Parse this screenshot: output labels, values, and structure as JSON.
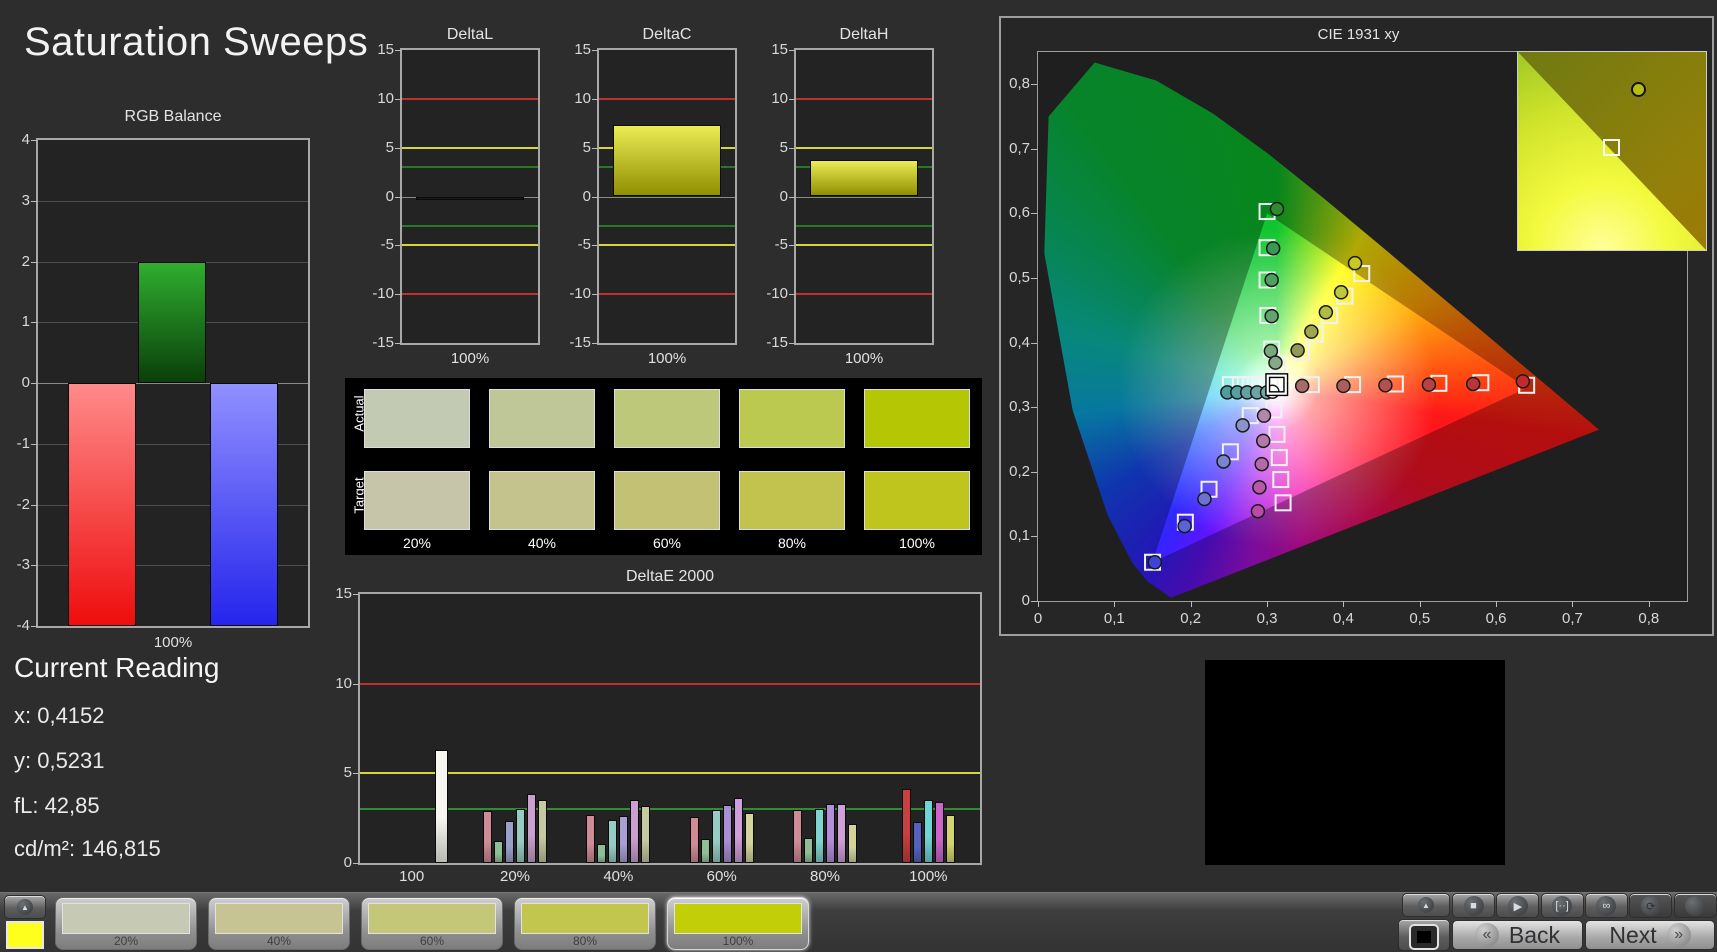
{
  "page": {
    "title": "Saturation Sweeps"
  },
  "current_reading": {
    "heading": "Current Reading",
    "lines": [
      "x: 0,4152",
      "y: 0,5231",
      "fL: 42,85",
      "cd/m²: 146,815"
    ]
  },
  "swatch_panel": {
    "row_labels": [
      "Actual",
      "Target"
    ],
    "column_labels": [
      "20%",
      "40%",
      "60%",
      "80%",
      "100%"
    ],
    "actual_colors": [
      "#c3cab3",
      "#bfc697",
      "#bdc87b",
      "#bcc950",
      "#b5c704"
    ],
    "target_colors": [
      "#c6c5a9",
      "#c4c28d",
      "#c3c274",
      "#c2c24e",
      "#bfc51d"
    ]
  },
  "bottom_bar": {
    "sample_color": "#ffff1e",
    "arrow_glyph": "▲",
    "patches": [
      {
        "label": "20%",
        "color": "#c6c9b3",
        "selected": false
      },
      {
        "label": "40%",
        "color": "#c5c492",
        "selected": false
      },
      {
        "label": "60%",
        "color": "#c4c778",
        "selected": false
      },
      {
        "label": "80%",
        "color": "#c2c64f",
        "selected": false
      },
      {
        "label": "100%",
        "color": "#c2cf08",
        "selected": true
      }
    ],
    "icons": [
      {
        "name": "stop",
        "glyph": "■",
        "disabled": false
      },
      {
        "name": "play",
        "glyph": "▶",
        "disabled": false
      },
      {
        "name": "bracket-dots",
        "glyph": "[··]",
        "disabled": false
      },
      {
        "name": "infinity",
        "glyph": "∞",
        "disabled": false
      },
      {
        "name": "refresh",
        "glyph": "⟳",
        "disabled": true
      },
      {
        "name": "blank",
        "glyph": "",
        "disabled": true
      }
    ],
    "nav": {
      "back_glyph": "«",
      "back_label": "Back",
      "next_label": "Next",
      "next_glyph": "»"
    }
  },
  "chart_data": [
    {
      "id": "rgb_balance",
      "type": "bar",
      "title": "RGB Balance",
      "xlabel": "100%",
      "ylim": [
        -4,
        4
      ],
      "yticks": [
        4,
        3,
        2,
        1,
        0,
        -1,
        -2,
        -3,
        -4
      ],
      "categories": [
        "Red",
        "Green",
        "Blue"
      ],
      "values": [
        -4,
        2,
        -4
      ],
      "bar_colors": [
        [
          "#ff8a8a",
          "#ee0d0d"
        ],
        [
          "#2fae2f",
          "#0a3f0a"
        ],
        [
          "#9090ff",
          "#2525ec"
        ]
      ]
    },
    {
      "id": "delta_l",
      "type": "delta_bar",
      "title": "DeltaL",
      "xlabel": "100%",
      "ylim": [
        -15,
        15
      ],
      "yticks": [
        15,
        10,
        5,
        0,
        -5,
        -10,
        -15
      ],
      "ref_lines": [
        {
          "value": 10,
          "color": "#c03030"
        },
        {
          "value": -10,
          "color": "#c03030"
        },
        {
          "value": 5,
          "color": "#d6d63a"
        },
        {
          "value": -5,
          "color": "#d6d63a"
        },
        {
          "value": 3,
          "color": "#267a26"
        },
        {
          "value": -3,
          "color": "#267a26"
        }
      ],
      "value": -0.35,
      "bar_color": [
        "#242424",
        "#101010"
      ]
    },
    {
      "id": "delta_c",
      "type": "delta_bar",
      "title": "DeltaC",
      "xlabel": "100%",
      "ylim": [
        -15,
        15
      ],
      "yticks": [
        15,
        10,
        5,
        0,
        -5,
        -10,
        -15
      ],
      "ref_lines": [
        {
          "value": 10,
          "color": "#c03030"
        },
        {
          "value": -10,
          "color": "#c03030"
        },
        {
          "value": 5,
          "color": "#d6d63a"
        },
        {
          "value": -5,
          "color": "#d6d63a"
        },
        {
          "value": 3,
          "color": "#267a26"
        },
        {
          "value": -3,
          "color": "#267a26"
        }
      ],
      "value": 7.3,
      "bar_color": [
        "#ecec55",
        "#8f8f02"
      ]
    },
    {
      "id": "delta_h",
      "type": "delta_bar",
      "title": "DeltaH",
      "xlabel": "100%",
      "ylim": [
        -15,
        15
      ],
      "yticks": [
        15,
        10,
        5,
        0,
        -5,
        -10,
        -15
      ],
      "ref_lines": [
        {
          "value": 10,
          "color": "#c03030"
        },
        {
          "value": -10,
          "color": "#c03030"
        },
        {
          "value": 5,
          "color": "#d6d63a"
        },
        {
          "value": -5,
          "color": "#d6d63a"
        },
        {
          "value": 3,
          "color": "#267a26"
        },
        {
          "value": -3,
          "color": "#267a26"
        }
      ],
      "value": 3.7,
      "bar_color": [
        "#ecec55",
        "#8f8f02"
      ]
    },
    {
      "id": "delta_e",
      "type": "grouped_bar",
      "title": "DeltaE 2000",
      "ylim": [
        0,
        15
      ],
      "yticks": [
        15,
        10,
        5,
        0
      ],
      "ref_lines": [
        {
          "value": 10,
          "color": "#c03030"
        },
        {
          "value": 5,
          "color": "#d6d63a"
        },
        {
          "value": 3,
          "color": "#2d8f2d"
        }
      ],
      "groups": [
        {
          "label": "100",
          "offset": 30,
          "bars": [
            {
              "color": "#f7f7f0",
              "value": 6.3,
              "width": 13
            }
          ]
        },
        {
          "label": "20%",
          "offset": 0,
          "bars": [
            {
              "color": "#cf8c94",
              "value": 2.9
            },
            {
              "color": "#8fbf96",
              "value": 1.25
            },
            {
              "color": "#9aa0cc",
              "value": 2.35
            },
            {
              "color": "#96ccc4",
              "value": 3.0
            },
            {
              "color": "#c9a0cf",
              "value": 3.85
            },
            {
              "color": "#c6c8a0",
              "value": 3.5
            }
          ]
        },
        {
          "label": "40%",
          "offset": 0,
          "bars": [
            {
              "color": "#cf8c94",
              "value": 2.7
            },
            {
              "color": "#8fbf96",
              "value": 1.05
            },
            {
              "color": "#96ccc4",
              "value": 2.4
            },
            {
              "color": "#a99fd4",
              "value": 2.6
            },
            {
              "color": "#cba0d0",
              "value": 3.5
            },
            {
              "color": "#c6c8a0",
              "value": 3.2
            }
          ]
        },
        {
          "label": "60%",
          "offset": 0,
          "bars": [
            {
              "color": "#cf8c94",
              "value": 2.55
            },
            {
              "color": "#8fbf96",
              "value": 1.35
            },
            {
              "color": "#96ccc4",
              "value": 2.95
            },
            {
              "color": "#a98fd4",
              "value": 3.25
            },
            {
              "color": "#cf9fd9",
              "value": 3.6
            },
            {
              "color": "#d4d4a0",
              "value": 2.8
            }
          ]
        },
        {
          "label": "80%",
          "offset": 0,
          "bars": [
            {
              "color": "#cf8c94",
              "value": 2.95
            },
            {
              "color": "#8fbf96",
              "value": 1.4
            },
            {
              "color": "#7fd4cf",
              "value": 3.0
            },
            {
              "color": "#b48fd9",
              "value": 3.3
            },
            {
              "color": "#d0a0d9",
              "value": 3.3
            },
            {
              "color": "#d4d49a",
              "value": 2.2
            }
          ]
        },
        {
          "label": "100%",
          "offset": 0,
          "bars": [
            {
              "color": "#c94040",
              "value": 4.1
            },
            {
              "color": "#5560c0",
              "value": 2.3
            },
            {
              "color": "#6fd4d4",
              "value": 3.5
            },
            {
              "color": "#cc66cc",
              "value": 3.4
            },
            {
              "color": "#d4d470",
              "value": 2.7
            }
          ]
        }
      ]
    },
    {
      "id": "cie",
      "type": "cie",
      "title": "CIE 1931 xy",
      "axis_max": 0.85,
      "x_tick_labels": [
        "0",
        "0,1",
        "0,2",
        "0,3",
        "0,4",
        "0,5",
        "0,6",
        "0,7",
        "0,8"
      ],
      "y_tick_labels": [
        "0,8",
        "0,7",
        "0,6",
        "0,5",
        "0,4",
        "0,3",
        "0,2",
        "0,1",
        "0"
      ],
      "gamut_triangle": [
        [
          0.64,
          0.33
        ],
        [
          0.3,
          0.6
        ],
        [
          0.15,
          0.06
        ]
      ],
      "white_target": [
        0.3127,
        0.335
      ],
      "white_measurement": [
        0.307,
        0.324
      ],
      "targets": [
        [
          0.3,
          0.603
        ],
        [
          0.3,
          0.547
        ],
        [
          0.3,
          0.497
        ],
        [
          0.301,
          0.442
        ],
        [
          0.306,
          0.39
        ],
        [
          0.314,
          0.366
        ],
        [
          0.345,
          0.385
        ],
        [
          0.363,
          0.413
        ],
        [
          0.382,
          0.442
        ],
        [
          0.402,
          0.472
        ],
        [
          0.424,
          0.507
        ],
        [
          0.358,
          0.335
        ],
        [
          0.412,
          0.335
        ],
        [
          0.468,
          0.336
        ],
        [
          0.525,
          0.337
        ],
        [
          0.58,
          0.338
        ],
        [
          0.64,
          0.334
        ],
        [
          0.252,
          0.335
        ],
        [
          0.265,
          0.335
        ],
        [
          0.278,
          0.335
        ],
        [
          0.291,
          0.335
        ],
        [
          0.304,
          0.335
        ],
        [
          0.309,
          0.296
        ],
        [
          0.313,
          0.258
        ],
        [
          0.316,
          0.222
        ],
        [
          0.318,
          0.188
        ],
        [
          0.321,
          0.152
        ],
        [
          0.278,
          0.287
        ],
        [
          0.252,
          0.231
        ],
        [
          0.224,
          0.173
        ],
        [
          0.193,
          0.122
        ],
        [
          0.15,
          0.06
        ]
      ],
      "measurements": [
        [
          0.313,
          0.607,
          "#2e8b2e"
        ],
        [
          0.308,
          0.546,
          "#3d9653"
        ],
        [
          0.306,
          0.497,
          "#4f9f63"
        ],
        [
          0.306,
          0.441,
          "#63a370"
        ],
        [
          0.305,
          0.387,
          "#79a77e"
        ],
        [
          0.311,
          0.369,
          "#85a98a"
        ],
        [
          0.34,
          0.388,
          "#8f9a55"
        ],
        [
          0.358,
          0.417,
          "#9fa84f"
        ],
        [
          0.377,
          0.447,
          "#aebb44"
        ],
        [
          0.397,
          0.478,
          "#bdc93a"
        ],
        [
          0.4152,
          0.5231,
          "#c9c926"
        ],
        [
          0.346,
          0.333,
          "#a96a6a"
        ],
        [
          0.4,
          0.333,
          "#ad5d5d"
        ],
        [
          0.455,
          0.334,
          "#b15050"
        ],
        [
          0.512,
          0.335,
          "#b54343"
        ],
        [
          0.57,
          0.336,
          "#ba3636"
        ],
        [
          0.635,
          0.34,
          "#c22b2b"
        ],
        [
          0.248,
          0.323,
          "#4d9d9d"
        ],
        [
          0.261,
          0.323,
          "#57a0a0"
        ],
        [
          0.274,
          0.323,
          "#61a3a3"
        ],
        [
          0.287,
          0.323,
          "#6ba6a6"
        ],
        [
          0.3,
          0.323,
          "#75a9a9"
        ],
        [
          0.296,
          0.287,
          "#b387ad"
        ],
        [
          0.295,
          0.248,
          "#b478ab"
        ],
        [
          0.293,
          0.212,
          "#b569a9"
        ],
        [
          0.29,
          0.176,
          "#b65aa7"
        ],
        [
          0.288,
          0.139,
          "#b74ba5"
        ],
        [
          0.268,
          0.272,
          "#8a94c9"
        ],
        [
          0.243,
          0.216,
          "#7a84cc"
        ],
        [
          0.218,
          0.158,
          "#6a73d2"
        ],
        [
          0.192,
          0.116,
          "#5a62d8"
        ],
        [
          0.153,
          0.06,
          "#3c45d6"
        ]
      ],
      "inset": {
        "circle": {
          "left_pct": 60,
          "top_pct": 15,
          "color": "#b9bd12"
        },
        "square": {
          "left_pct": 45,
          "top_pct": 44
        }
      }
    }
  ]
}
